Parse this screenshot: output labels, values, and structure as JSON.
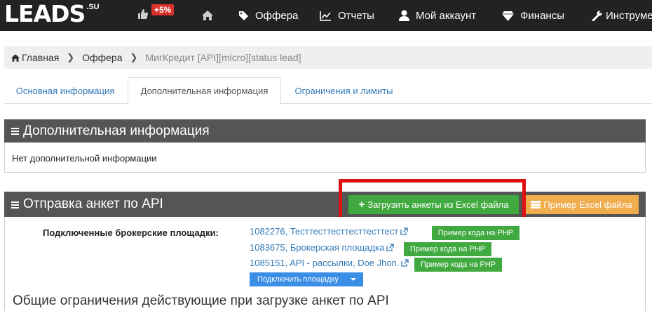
{
  "colors": {
    "nav_bg": "#222222",
    "badge": "#d9312b",
    "panel_head": "#555555",
    "green": "#40a93f",
    "orange": "#f0ad4e",
    "link": "#337ab7",
    "highlight_frame": "#dd1111"
  },
  "brand": {
    "name": "LEADS",
    "suffix": ".SU"
  },
  "topnav": {
    "badge": "+5%",
    "items": [
      {
        "icon": "home-icon",
        "label": ""
      },
      {
        "icon": "tag-icon",
        "label": "Оффера"
      },
      {
        "icon": "chart-icon",
        "label": "Отчеты"
      },
      {
        "icon": "user-icon",
        "label": "Мой аккаунт"
      },
      {
        "icon": "diamond-icon",
        "label": "Финансы"
      },
      {
        "icon": "wrench-icon",
        "label": "Инструме"
      }
    ]
  },
  "breadcrumb": {
    "items": [
      "Главная",
      "Оффера",
      "МигКредит [API][micro][status lead]"
    ]
  },
  "tabs": [
    {
      "label": "Основная информация",
      "active": false
    },
    {
      "label": "Дополнительная информация",
      "active": true
    },
    {
      "label": "Ограничения и лимиты",
      "active": false
    }
  ],
  "extra_panel": {
    "title": "Дополнительная информация",
    "body": "Нет дополнительной информации"
  },
  "api_panel": {
    "title": "Отправка анкет по API",
    "upload_button": "Загрузить анкеты из Excel файла",
    "example_button": "Пример Excel файла",
    "brokers_label": "Подключенные брокерские площадки:",
    "brokers": [
      {
        "name": "1082276, Тесттесттесттесттесттест",
        "code_button": "Пример кода на PHP"
      },
      {
        "name": "1083675, Брокерская площадка",
        "code_button": "Пример кода на PHP"
      },
      {
        "name": "1085151, API - рассылки, Doe Jhon.",
        "code_button": "Пример кода на PHP"
      }
    ],
    "connect_button": "Подключить площадку",
    "limits_heading": "Общие ограничения действующие при загрузке анкет по API"
  }
}
